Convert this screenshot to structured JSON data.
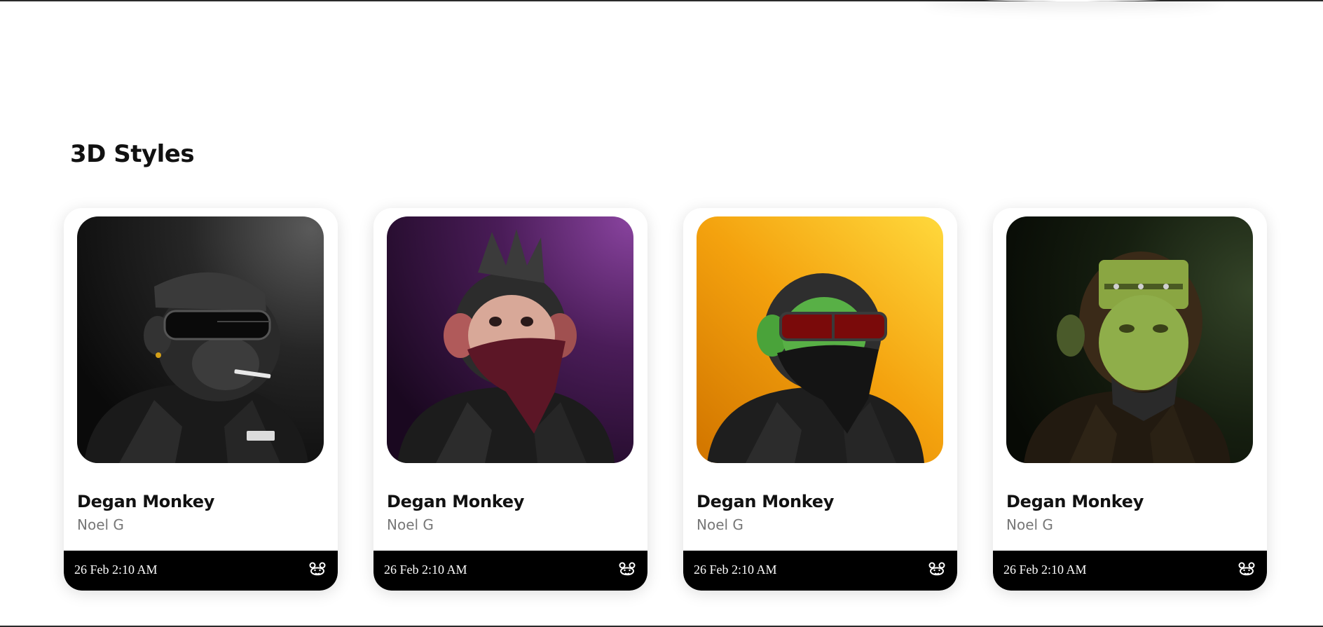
{
  "section": {
    "title": "3D Styles"
  },
  "cards": [
    {
      "title": "Degan Monkey",
      "author": "Noel G",
      "date": "26 Feb 2:10 AM",
      "image": "monkey-cap-sunglasses-cigarette",
      "background_colors": [
        "#3a3a3a",
        "#0c0c0c"
      ],
      "icon": "bear-icon"
    },
    {
      "title": "Degan Monkey",
      "author": "Noel G",
      "date": "26 Feb 2:10 AM",
      "image": "monkey-mohawk-red-bandana",
      "background_colors": [
        "#7a3a8c",
        "#1e0a24"
      ],
      "icon": "bear-icon"
    },
    {
      "title": "Degan Monkey",
      "author": "Noel G",
      "date": "26 Feb 2:10 AM",
      "image": "monkey-green-face-red-sunglasses",
      "background_colors": [
        "#ffd63a",
        "#e58a00"
      ],
      "icon": "bear-icon"
    },
    {
      "title": "Degan Monkey",
      "author": "Noel G",
      "date": "26 Feb 2:10 AM",
      "image": "monkey-frankenstein-green",
      "background_colors": [
        "#2f3d22",
        "#0b1008"
      ],
      "icon": "bear-icon"
    }
  ]
}
